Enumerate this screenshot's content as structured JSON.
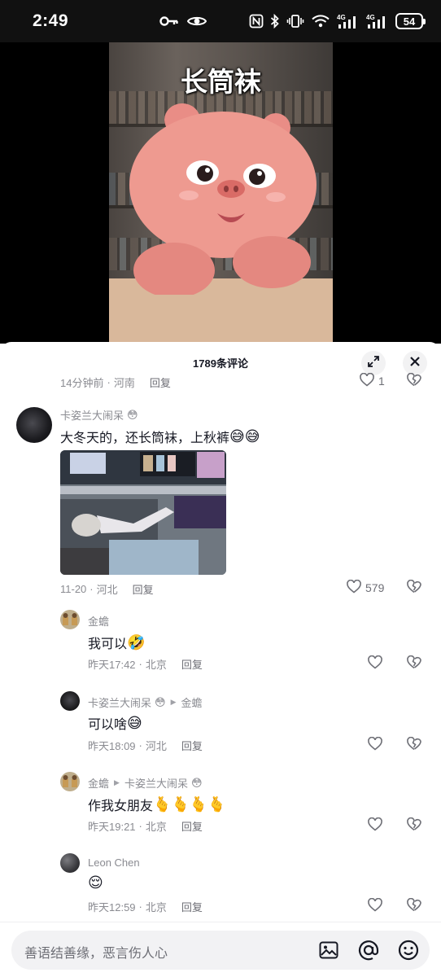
{
  "status_bar": {
    "time": "2:49",
    "battery": "54",
    "signal_1_label": "4G",
    "signal_2_label": "4G"
  },
  "video": {
    "caption": "长筒袜"
  },
  "comments_panel": {
    "title": "1789条评论",
    "top_partial": {
      "time": "14分钟前",
      "location": "河南",
      "reply_label": "回复",
      "like_count": "1"
    },
    "main_comment": {
      "username": "卡姿兰大闹呆",
      "text": "大冬天的，还长筒袜，上秋裤",
      "time": "11-20",
      "location": "河北",
      "reply_label": "回复",
      "like_count": "579"
    },
    "replies": [
      {
        "username": "金蟾",
        "reply_to": "",
        "text": "我可以",
        "time": "昨天17:42",
        "location": "北京",
        "reply_label": "回复"
      },
      {
        "username": "卡姿兰大闹呆",
        "reply_to": "金蟾",
        "text": "可以啥",
        "time": "昨天18:09",
        "location": "河北",
        "reply_label": "回复"
      },
      {
        "username": "金蟾",
        "reply_to": "卡姿兰大闹呆",
        "text": "作我女朋友",
        "time": "昨天19:21",
        "location": "北京",
        "reply_label": "回复"
      },
      {
        "username": "Leon Chen",
        "reply_to": "",
        "text": "",
        "time": "昨天12:59",
        "location": "北京",
        "reply_label": "回复"
      }
    ],
    "separator": "·"
  },
  "input_bar": {
    "placeholder": "善语结善缘，恶言伤人心"
  },
  "colors": {
    "accent_pig": "#e98d86",
    "text_primary": "#161823",
    "text_secondary": "#8a8b91"
  }
}
